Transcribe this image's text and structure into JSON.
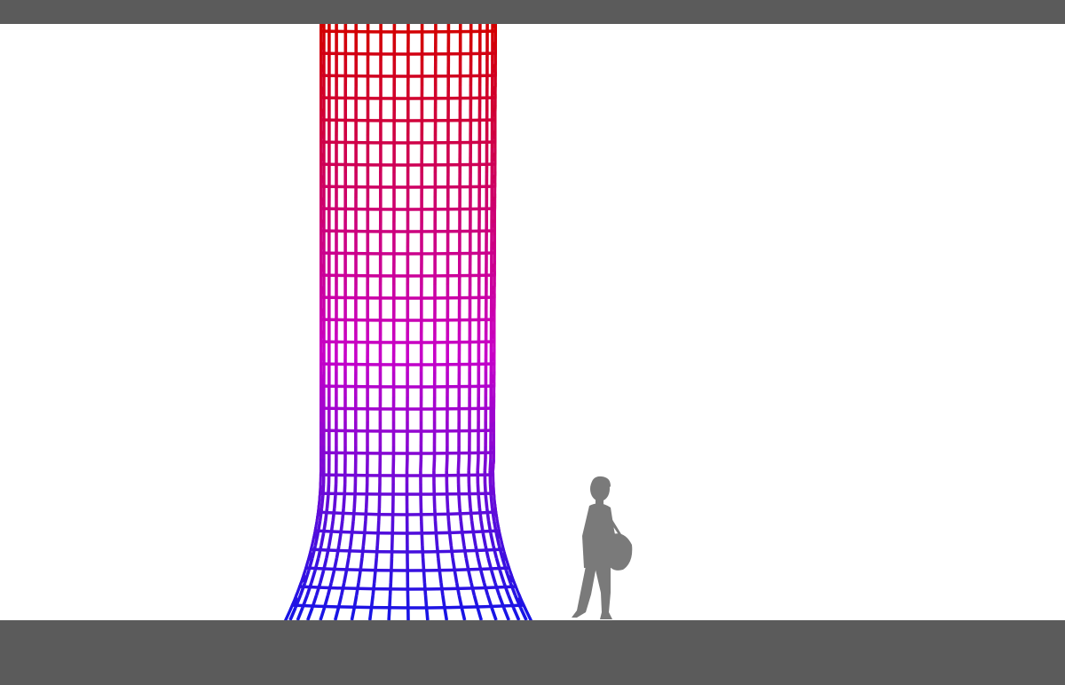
{
  "scene": {
    "colors": {
      "background": "#ffffff",
      "slab": "#5b5b5b",
      "silhouette": "#7a7a7a",
      "column_top": "#d30000",
      "column_mid": "#c800c8",
      "column_bottom": "#1414e6"
    },
    "elements": {
      "ceiling": "ceiling-slab",
      "floor": "floor-slab",
      "column": "lattice-column",
      "person": "person-silhouette",
      "bag": "shoulder-bag"
    }
  }
}
